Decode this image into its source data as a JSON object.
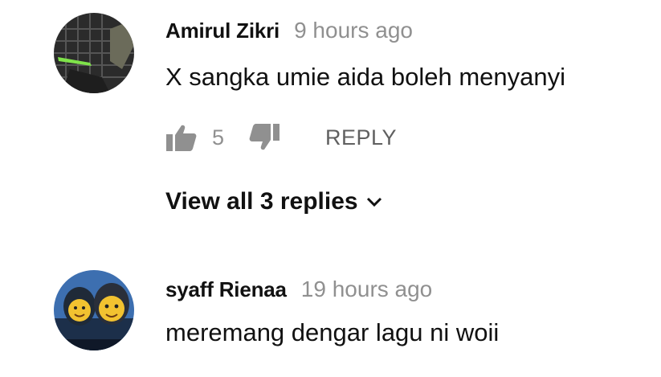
{
  "comments": [
    {
      "author": "Amirul Zikri",
      "timestamp": "9 hours ago",
      "text": "X sangka umie aida boleh menyanyi",
      "like_count": "5",
      "like_icon": "thumb-up-icon",
      "dislike_icon": "thumb-down-icon",
      "reply_label": "REPLY",
      "view_replies_label": "View all 3 replies",
      "view_replies_icon": "chevron-down-icon"
    },
    {
      "author": "syaff Rienaa",
      "timestamp": "19 hours ago",
      "text": "meremang dengar lagu ni woii"
    }
  ],
  "colors": {
    "primary_text": "#111111",
    "secondary_text": "#909090",
    "icon": "#909090",
    "reply": "#606060"
  }
}
